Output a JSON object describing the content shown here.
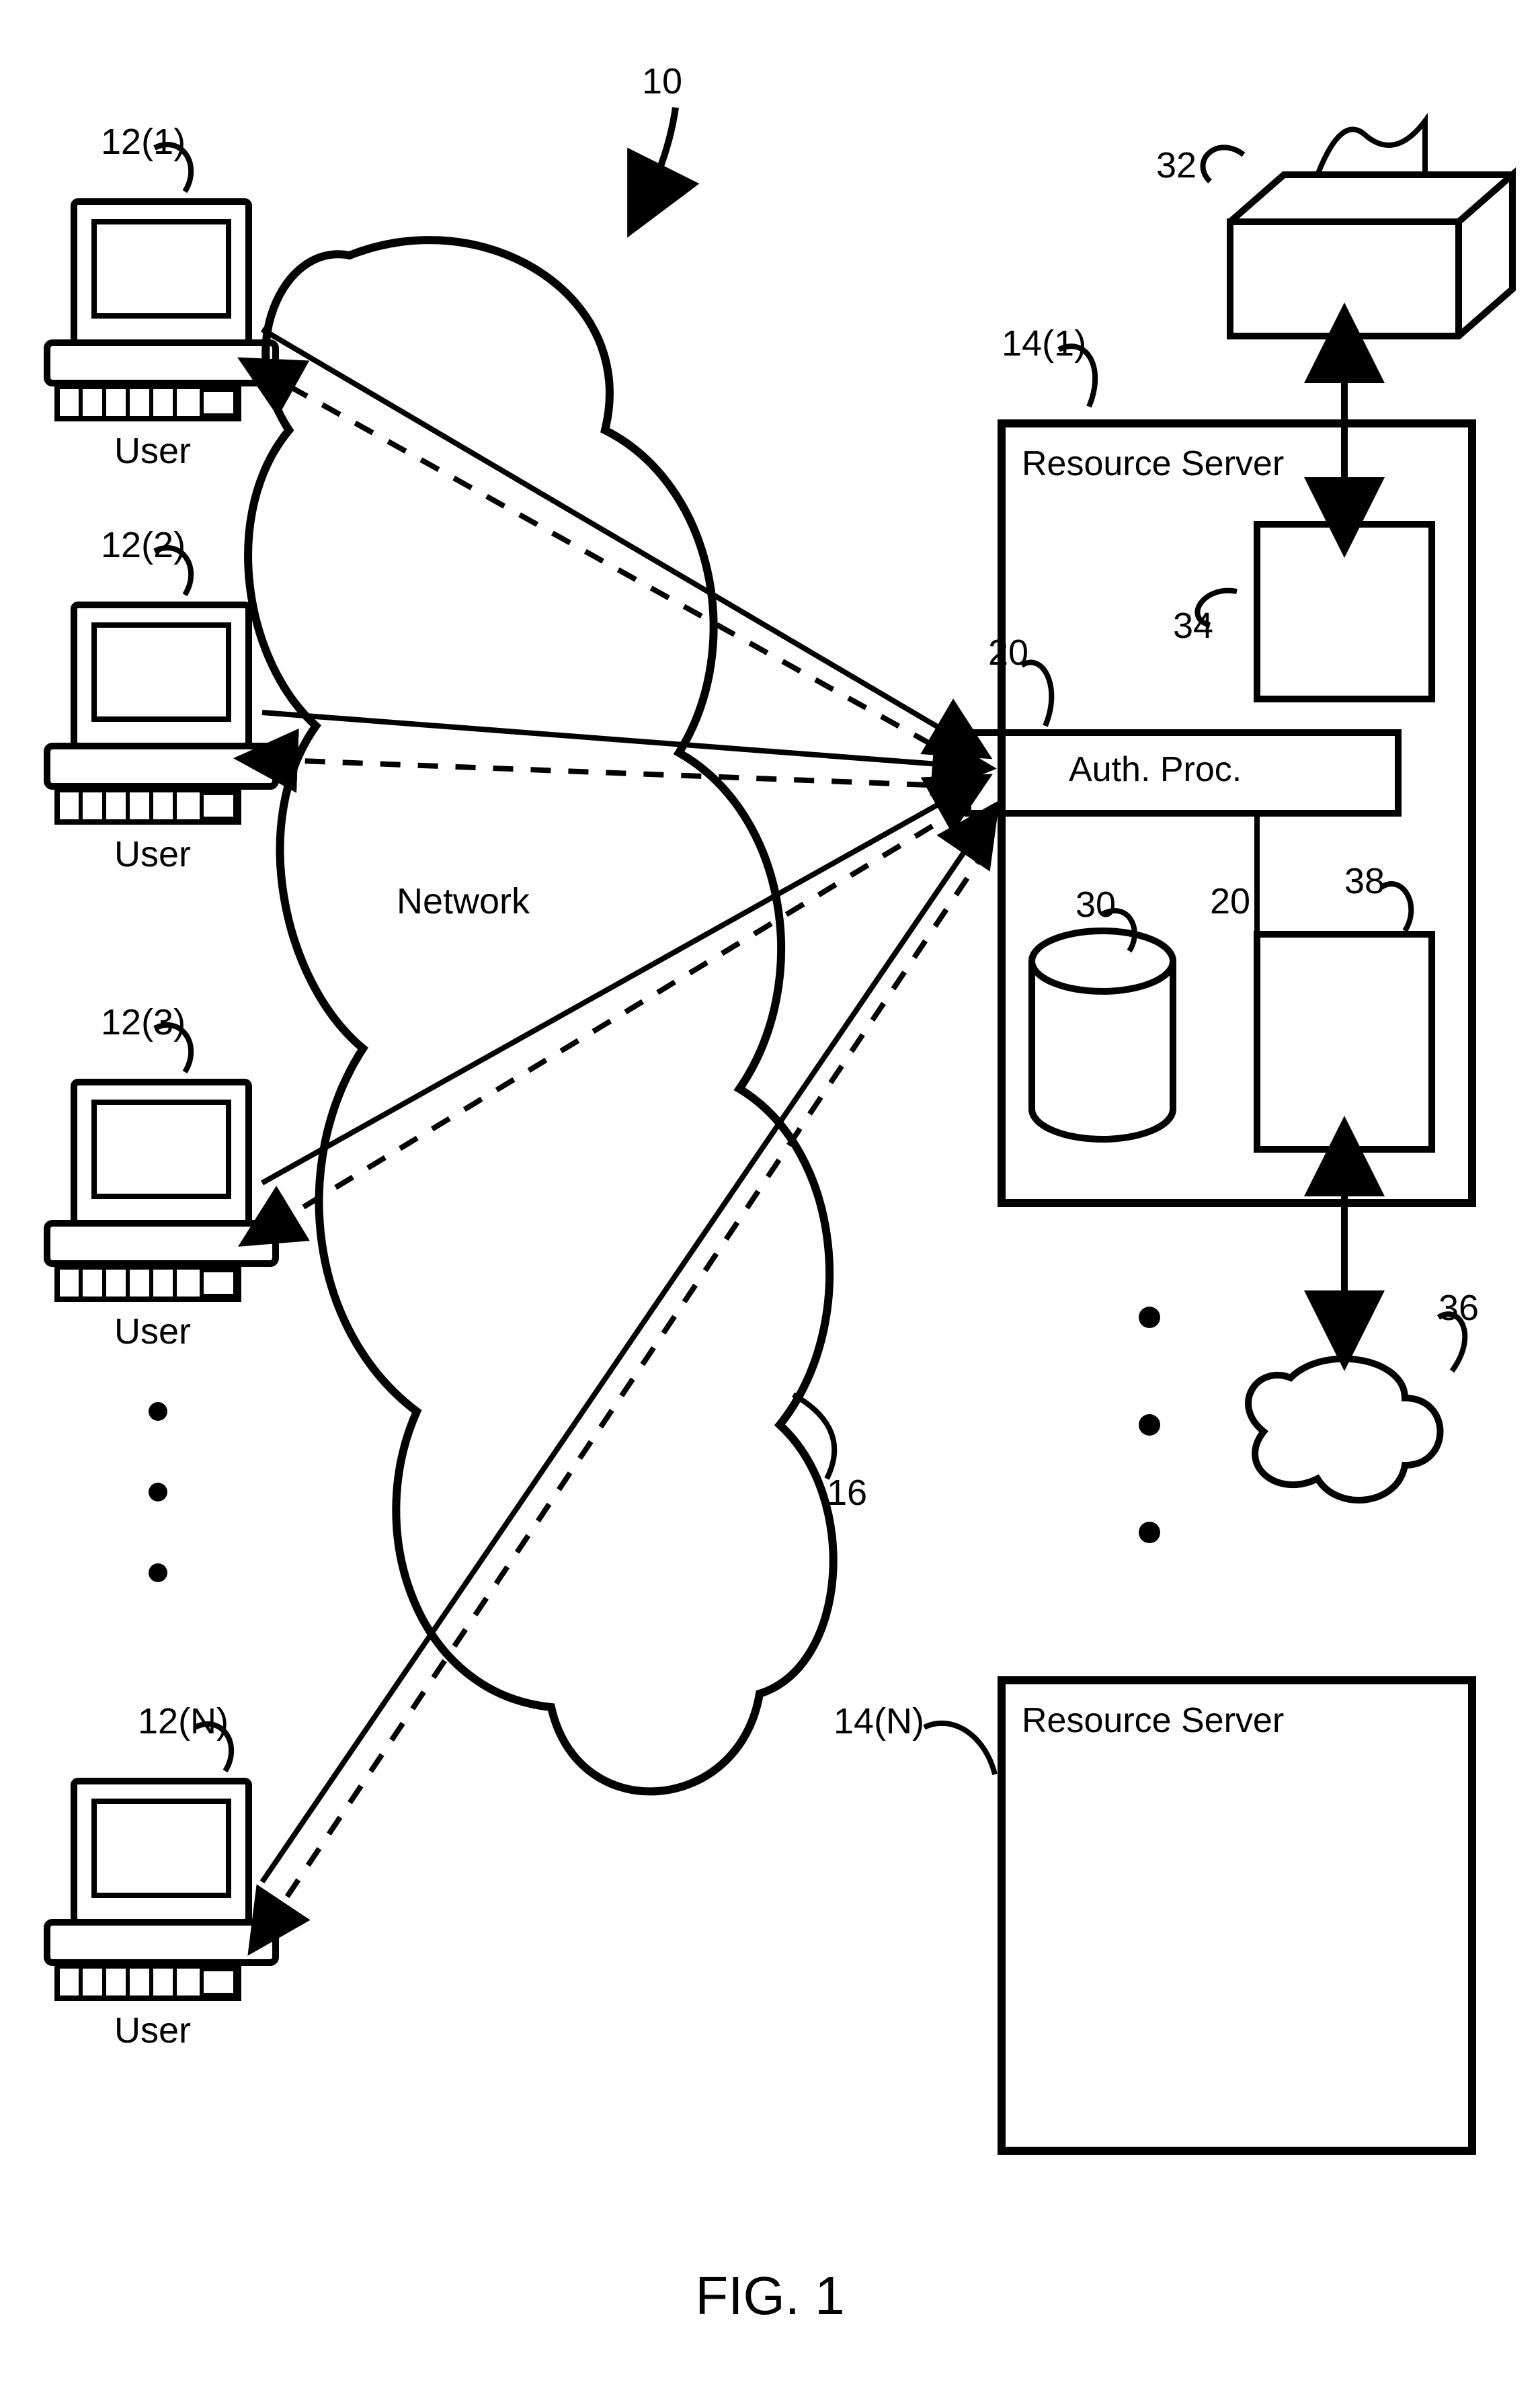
{
  "figure": {
    "caption": "FIG. 1",
    "system_ref": "10",
    "network_label": "Network",
    "network_ref": "16",
    "users": [
      {
        "ref": "12(1)",
        "label": "User"
      },
      {
        "ref": "12(2)",
        "label": "User"
      },
      {
        "ref": "12(3)",
        "label": "User"
      },
      {
        "ref": "12(N)",
        "label": "User"
      }
    ],
    "servers": {
      "first": {
        "ref": "14(1)",
        "label": "Resource Server"
      },
      "last": {
        "ref": "14(N)",
        "label": "Resource Server"
      }
    },
    "auth_proc": {
      "ref": "20",
      "label": "Auth. Proc.",
      "ref2": "20"
    },
    "components": {
      "printer_ref": "32",
      "printer_interface_ref": "34",
      "database_ref": "30",
      "net_interface_ref": "38",
      "small_cloud_ref": "36"
    }
  }
}
